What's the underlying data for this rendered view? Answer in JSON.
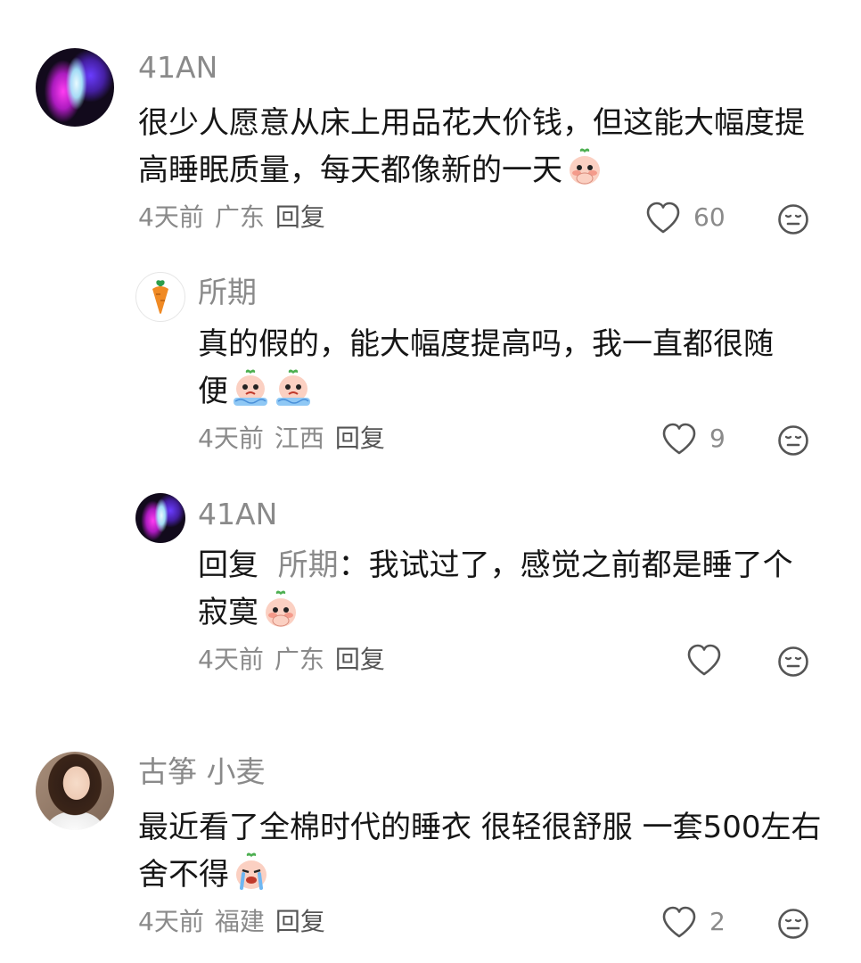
{
  "comments": [
    {
      "username": "41AN",
      "avatar_icon": "aurora-avatar",
      "text": "很少人愿意从床上用品花大价钱，但这能大幅度提高睡眠质量，每天都像新的一天",
      "time": "4天前",
      "location": "广东",
      "reply_label": "回复",
      "likes": "60",
      "emoji": "peach-shy-emoji"
    },
    {
      "username": "所期",
      "avatar_icon": "carrot-avatar",
      "text": "真的假的，能大幅度提高吗，我一直都很随便",
      "time": "4天前",
      "location": "江西",
      "reply_label": "回复",
      "likes": "9",
      "emoji": "peach-cry-emoji"
    },
    {
      "username": "41AN",
      "avatar_icon": "aurora-avatar",
      "reply_prefix": "回复",
      "mention": "所期",
      "text": "：我试过了，感觉之前都是睡了个寂寞",
      "time": "4天前",
      "location": "广东",
      "reply_label": "回复",
      "likes": "",
      "emoji": "peach-shy-emoji"
    },
    {
      "username": "古筝 小麦",
      "avatar_icon": "girl-photo-avatar",
      "text": "最近看了全棉时代的睡衣  很轻很舒服 一套500左右   舍不得",
      "time": "4天前",
      "location": "福建",
      "reply_label": "回复",
      "likes": "2",
      "emoji": "peach-sob-emoji"
    }
  ],
  "colors": {
    "text": "#161616",
    "secondary": "#8a8a8a",
    "background": "#ffffff"
  }
}
